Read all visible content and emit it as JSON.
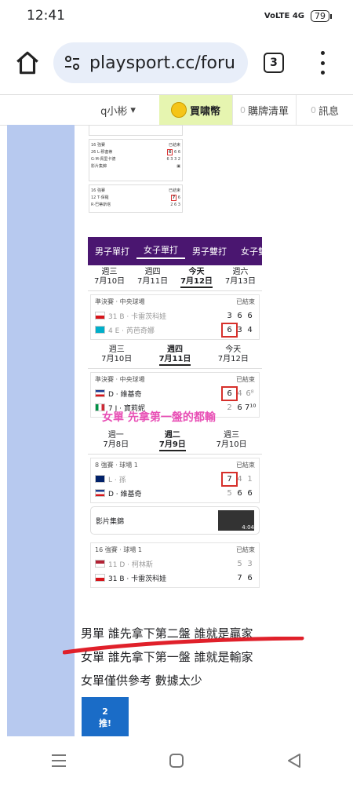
{
  "status": {
    "time": "12:41",
    "network": "VoLTE 4G",
    "battery": "79"
  },
  "browser": {
    "url": "playsport.cc/foru",
    "tab_count": "3"
  },
  "site": {
    "username": "q小彬",
    "coin_label": "買啸幣",
    "cart_count": "0",
    "cart_label": "購牌清單",
    "msg_count": "0",
    "msg_label": "訊息"
  },
  "tennis": {
    "tabs": [
      "男子單打",
      "女子單打",
      "男子雙打",
      "女子雙"
    ],
    "days_a": [
      {
        "d": "週三",
        "date": "7月10日"
      },
      {
        "d": "週四",
        "date": "7月11日"
      },
      {
        "d": "今天",
        "date": "7月12日"
      },
      {
        "d": "週六",
        "date": "7月13日"
      }
    ],
    "card1": {
      "round": "準決賽 · 中央球場",
      "status": "已結束",
      "p1": "31 B · 卡雷茨科娃",
      "p1_scores": [
        "3",
        "6",
        "6"
      ],
      "p2": "4 E · 芮芭奇娜",
      "p2_scores": [
        "6",
        "3",
        "4"
      ]
    },
    "days_b": [
      {
        "d": "週三",
        "date": "7月10日"
      },
      {
        "d": "週四",
        "date": "7月11日"
      },
      {
        "d": "今天",
        "date": "7月12日"
      }
    ],
    "card2": {
      "round": "準決賽 · 中央球場",
      "status": "已結束",
      "p1": "D · 維基奇",
      "p1_scores": [
        "6",
        "4",
        "6⁸"
      ],
      "p2": "7 J · 寶莉妮",
      "p2_scores": [
        "2",
        "6",
        "7¹⁰"
      ]
    },
    "watermark": "女單 先拿第一盤的都輸",
    "days_c": [
      {
        "d": "週一",
        "date": "7月8日"
      },
      {
        "d": "週二",
        "date": "7月9日"
      },
      {
        "d": "週三",
        "date": "7月10日"
      }
    ],
    "card3": {
      "round": "8 強賽 · 球場 1",
      "status": "已結束",
      "p1": "L · 孫",
      "p1_scores": [
        "7",
        "4",
        "1"
      ],
      "p2": "D · 維基奇",
      "p2_scores": [
        "5",
        "6",
        "6"
      ]
    },
    "video_label": "影片集錦",
    "video_time": "4:04",
    "card4": {
      "round": "16 強賽 · 球場 1",
      "status": "已結束",
      "p1": "11 D · 柯林斯",
      "p1_scores": [
        "5",
        "3"
      ],
      "p2": "31 B · 卡雷茨科娃",
      "p2_scores": [
        "7",
        "6"
      ]
    }
  },
  "post": {
    "line1": "男單 誰先拿下第二盤 誰就是贏家",
    "line2": "女單 誰先拿下第一盤 誰就是輸家",
    "line3": "女單僅供參考 數據太少"
  },
  "sticker": {
    "num": "2",
    "word": "推!"
  },
  "colors": {
    "left_panel": "#b7c9ef",
    "tennis_nav": "#4a1670",
    "highlight": "#d6302b",
    "coin_bg": "#e6f5b0"
  }
}
